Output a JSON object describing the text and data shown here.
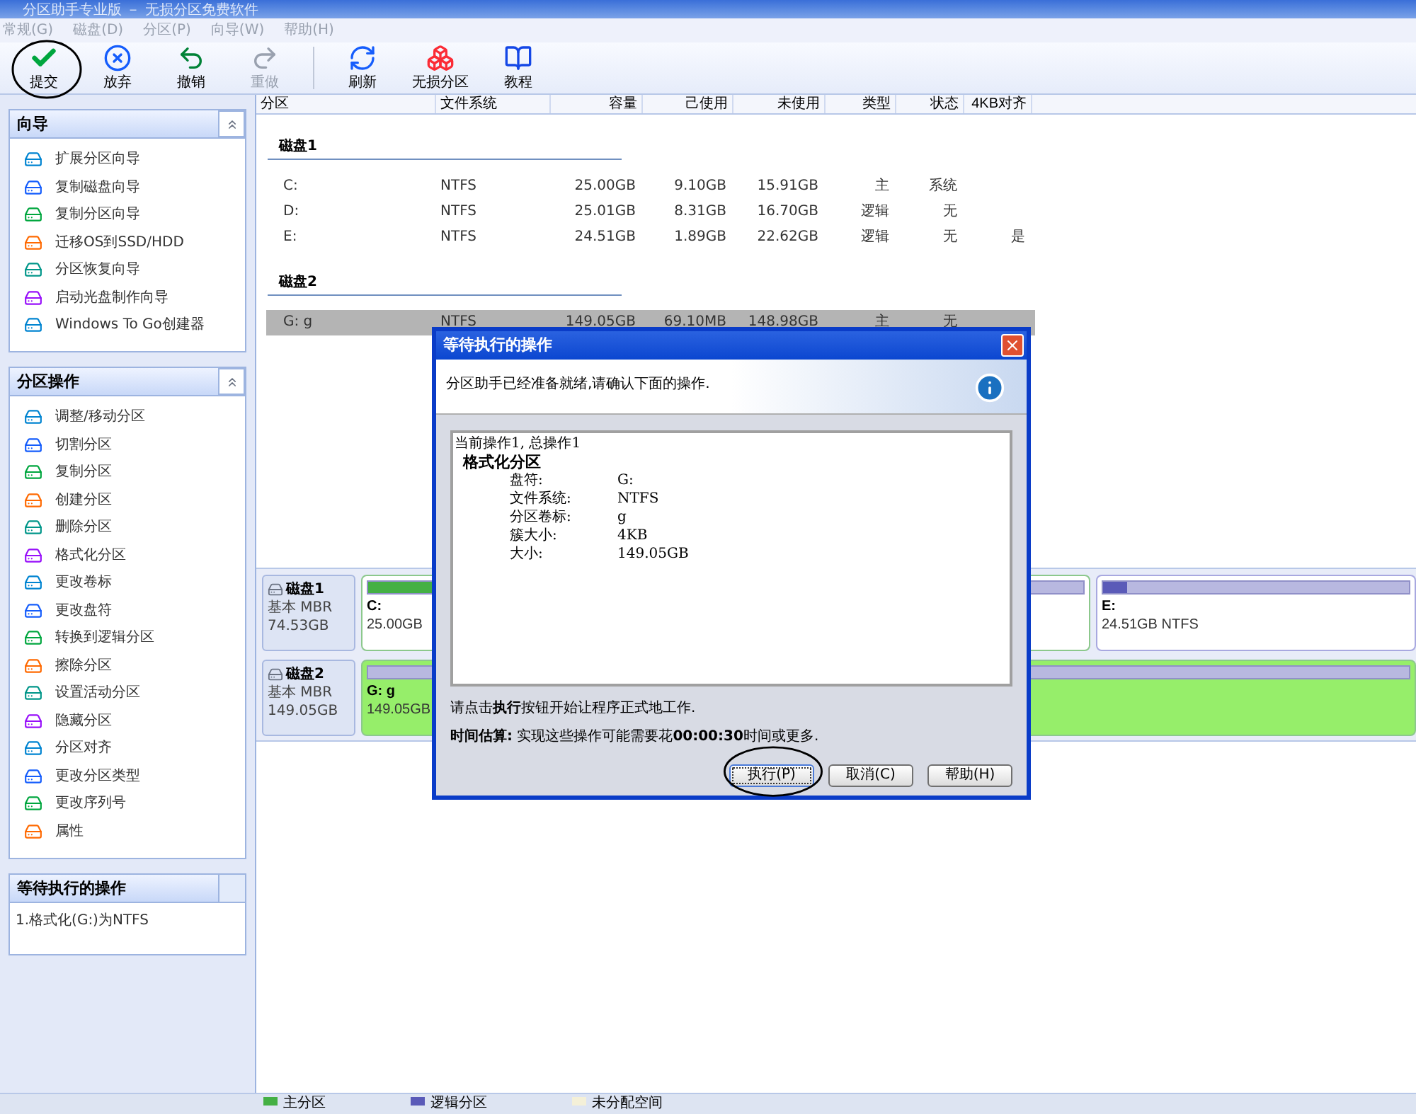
{
  "window": {
    "title": "分区助手专业版 － 无损分区免费软件"
  },
  "menu": [
    "常规(G)",
    "磁盘(D)",
    "分区(P)",
    "向导(W)",
    "帮助(H)"
  ],
  "toolbar": [
    {
      "kind": "check",
      "label": "提交",
      "disabled": false
    },
    {
      "kind": "discard",
      "label": "放弃",
      "disabled": false
    },
    {
      "kind": "undo",
      "label": "撤销",
      "disabled": false
    },
    {
      "kind": "redo",
      "label": "重做",
      "disabled": true
    },
    {
      "kind": "sep"
    },
    {
      "kind": "refresh",
      "label": "刷新",
      "disabled": false
    },
    {
      "kind": "lossless",
      "label": "无损分区",
      "disabled": false
    },
    {
      "kind": "tutorial",
      "label": "教程",
      "disabled": false
    }
  ],
  "wizard_panel": {
    "title": "向导",
    "expanded": true,
    "items": [
      "扩展分区向导",
      "复制磁盘向导",
      "复制分区向导",
      "迁移OS到SSD/HDD",
      "分区恢复向导",
      "启动光盘制作向导",
      "Windows To Go创建器"
    ]
  },
  "partition_panel": {
    "title": "分区操作",
    "expanded": true,
    "items": [
      "调整/移动分区",
      "切割分区",
      "复制分区",
      "创建分区",
      "删除分区",
      "格式化分区",
      "更改卷标",
      "更改盘符",
      "转换到逻辑分区",
      "擦除分区",
      "设置活动分区",
      "隐藏分区",
      "分区对齐",
      "更改分区类型",
      "更改序列号",
      "属性"
    ]
  },
  "pending_panel": {
    "title": "等待执行的操作",
    "items": [
      "1.格式化(G:)为NTFS"
    ]
  },
  "table": {
    "columns": [
      "分区",
      "文件系统",
      "容量",
      "己使用",
      "未使用",
      "类型",
      "状态",
      "4KB对齐"
    ],
    "groups": [
      {
        "name": "磁盘1",
        "rows": [
          {
            "cells": [
              "C:",
              "NTFS",
              "25.00GB",
              "9.10GB",
              "15.91GB",
              "主",
              "系统",
              ""
            ],
            "selected": false
          },
          {
            "cells": [
              "D:",
              "NTFS",
              "25.01GB",
              "8.31GB",
              "16.70GB",
              "逻辑",
              "无",
              ""
            ],
            "selected": false
          },
          {
            "cells": [
              "E:",
              "NTFS",
              "24.51GB",
              "1.89GB",
              "22.62GB",
              "逻辑",
              "无",
              "是"
            ],
            "selected": false
          }
        ]
      },
      {
        "name": "磁盘2",
        "rows": [
          {
            "cells": [
              "G: g",
              "NTFS",
              "149.05GB",
              "69.10MB",
              "148.98GB",
              "主",
              "无",
              ""
            ],
            "selected": true
          }
        ]
      }
    ]
  },
  "disk_map": [
    {
      "name": "磁盘1",
      "type": "基本 MBR",
      "size": "74.53GB",
      "partitions": [
        {
          "kind": "primary",
          "label": "C:",
          "detail": "25.00GB",
          "level": 0.36,
          "selected": false
        },
        {
          "kind": "logical",
          "label": "E:",
          "detail": "24.51GB NTFS",
          "level": 0.08,
          "selected": false
        }
      ]
    },
    {
      "name": "磁盘2",
      "type": "基本 MBR",
      "size": "149.05GB",
      "partitions": [
        {
          "kind": "primary",
          "label": "G: g",
          "detail": "149.05GB",
          "selected": true
        }
      ]
    }
  ],
  "dialog": {
    "title": "等待执行的操作",
    "intro": "分区助手已经准备就绪,请确认下面的操作.",
    "summary": "当前操作1, 总操作1",
    "operation": "格式化分区",
    "details": [
      {
        "label": "盘符:",
        "value": "G:"
      },
      {
        "label": "文件系统:",
        "value": "NTFS"
      },
      {
        "label": "分区卷标:",
        "value": "g"
      },
      {
        "label": "簇大小:",
        "value": "4KB"
      },
      {
        "label": "大小:",
        "value": "149.05GB"
      }
    ],
    "hint": "请点击**执行**按钮开始让程序正式地工作.",
    "estimate": "**时间估算:** 实现这些操作可能需要花**00:00:30**时间或更多.",
    "buttons": [
      {
        "label": "执行(P)",
        "default": true
      },
      {
        "label": "取消(C)",
        "default": false
      },
      {
        "label": "帮助(H)",
        "default": false
      }
    ]
  },
  "legend": [
    {
      "label": "主分区",
      "color": "#44b044"
    },
    {
      "label": "逻辑分区",
      "color": "#5a5ab8"
    },
    {
      "label": "未分配空间",
      "color": "#f4f0d8"
    }
  ]
}
